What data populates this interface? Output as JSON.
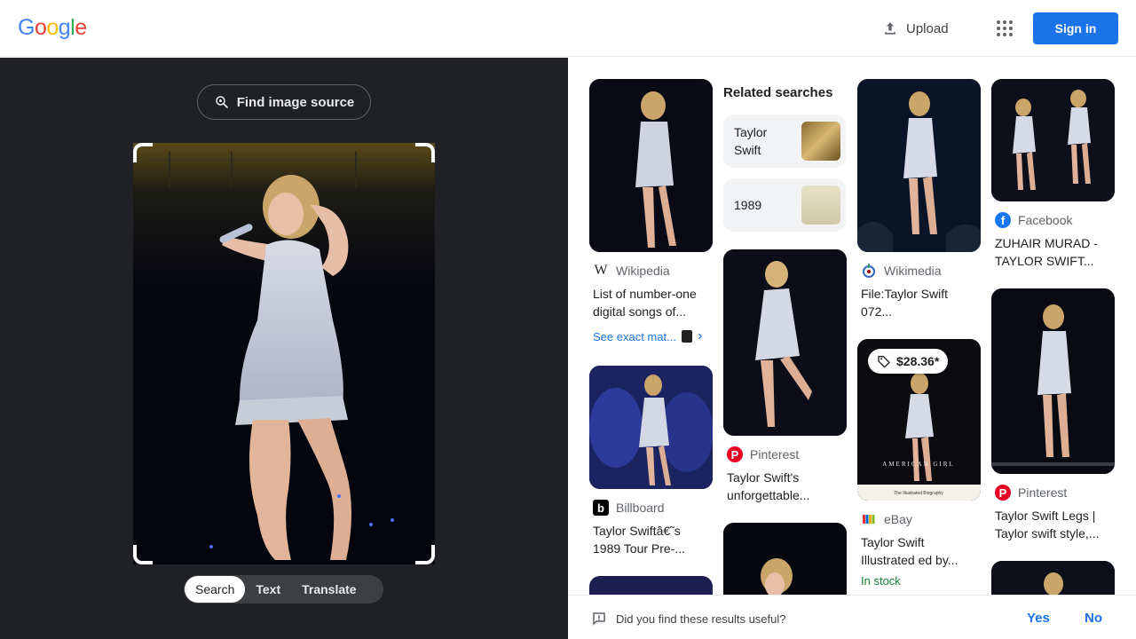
{
  "header": {
    "logo_letters": [
      "G",
      "o",
      "o",
      "g",
      "l",
      "e"
    ],
    "logo_colors": [
      "#4285F4",
      "#EA4335",
      "#FBBC05",
      "#4285F4",
      "#34A853",
      "#EA4335"
    ],
    "upload_label": "Upload",
    "signin_label": "Sign in"
  },
  "lens": {
    "find_source_label": "Find image source",
    "modes": [
      {
        "label": "Search",
        "active": true
      },
      {
        "label": "Text",
        "active": false
      },
      {
        "label": "Translate",
        "active": false
      }
    ]
  },
  "results": {
    "related_heading": "Related searches",
    "related": [
      {
        "line1": "Taylor",
        "line2": "Swift"
      },
      {
        "line1": "1989",
        "line2": ""
      }
    ],
    "items": [
      {
        "source": "Wikipedia",
        "icon": "wikipedia-icon",
        "title_line1": "List of number-one",
        "title_line2": "digital songs of..."
      },
      {
        "source": "Billboard",
        "icon": "billboard-icon",
        "title_line1": "Taylor Swiftâ€˜s",
        "title_line2": "1989 Tour Pre-..."
      },
      {
        "source": "Pinterest",
        "icon": "pinterest-icon",
        "title_line1": "Taylor Swift's",
        "title_line2": "unforgettable..."
      },
      {
        "source": "Wikimedia",
        "icon": "wikimedia-icon",
        "title_line1": "File:Taylor Swift",
        "title_line2": "072..."
      },
      {
        "source": "eBay",
        "icon": "ebay-icon",
        "title_line1": "Taylor Swift",
        "title_line2": "Illustrated ed by..."
      },
      {
        "source": "Facebook",
        "icon": "facebook-icon",
        "title_line1": "ZUHAIR MURAD -",
        "title_line2": "TAYLOR SWIFT..."
      },
      {
        "source": "Pinterest",
        "icon": "pinterest-icon",
        "title_line1": "Taylor Swift Legs |",
        "title_line2": "Taylor swift style,..."
      }
    ],
    "see_exact_label": "See exact mat...",
    "price_label": "$28.36*",
    "in_stock_label": "In stock",
    "book_cover_text": "AMERICAN GIRL",
    "book_subtitle": "The Illustrated Biography"
  },
  "feedback": {
    "question": "Did you find these results useful?",
    "yes_label": "Yes",
    "no_label": "No"
  },
  "colors": {
    "accent": "#1a73e8",
    "dark_panel": "#202124",
    "in_stock": "#188038"
  }
}
